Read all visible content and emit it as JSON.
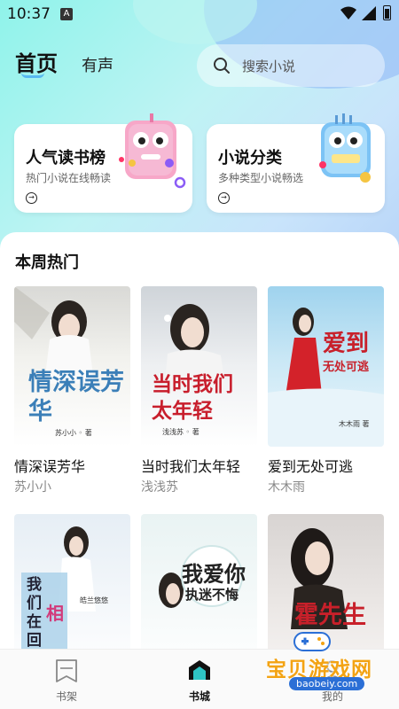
{
  "status": {
    "time": "10:37",
    "indicator": "A"
  },
  "header": {
    "tabs": [
      {
        "label": "首页",
        "active": true
      },
      {
        "label": "有声",
        "active": false
      }
    ],
    "search_placeholder": "搜索小说"
  },
  "cards": [
    {
      "title": "人气读书榜",
      "subtitle": "热门小说在线畅读",
      "arrow": "→"
    },
    {
      "title": "小说分类",
      "subtitle": "多种类型小说畅选",
      "arrow": "→"
    }
  ],
  "section": {
    "title": "本周热门"
  },
  "books": [
    {
      "title": "情深误芳华",
      "author": "苏小小",
      "cover_title": "情深误芳华",
      "cover_author": "苏小小 ◦ 著"
    },
    {
      "title": "当时我们太年轻",
      "author": "浅浅苏",
      "cover_title": "当时我们太年轻",
      "cover_author": "浅浅苏 ◦ 著"
    },
    {
      "title": "爱到无处可逃",
      "author": "木木雨",
      "cover_title": "爱到",
      "cover_title2": "无处可逃",
      "cover_author": "木木雨 著"
    },
    {
      "cover_title": "我们在回",
      "cover_accent": "相",
      "cover_author": "皓兰悠悠"
    },
    {
      "cover_title": "我爱你",
      "cover_title2": "执迷不悔"
    },
    {
      "cover_title": "霍先生"
    }
  ],
  "nav": [
    {
      "label": "书架",
      "icon": "bookshelf-icon",
      "active": false
    },
    {
      "label": "书城",
      "icon": "bookstore-icon",
      "active": true
    },
    {
      "label": "我的",
      "icon": "profile-icon",
      "active": false
    }
  ],
  "watermark": {
    "text": "宝贝游戏网",
    "url": "baobeiy.com"
  },
  "colors": {
    "accent": "#58b8f0",
    "nav_active": "#111111",
    "watermark": "#f3a313"
  }
}
